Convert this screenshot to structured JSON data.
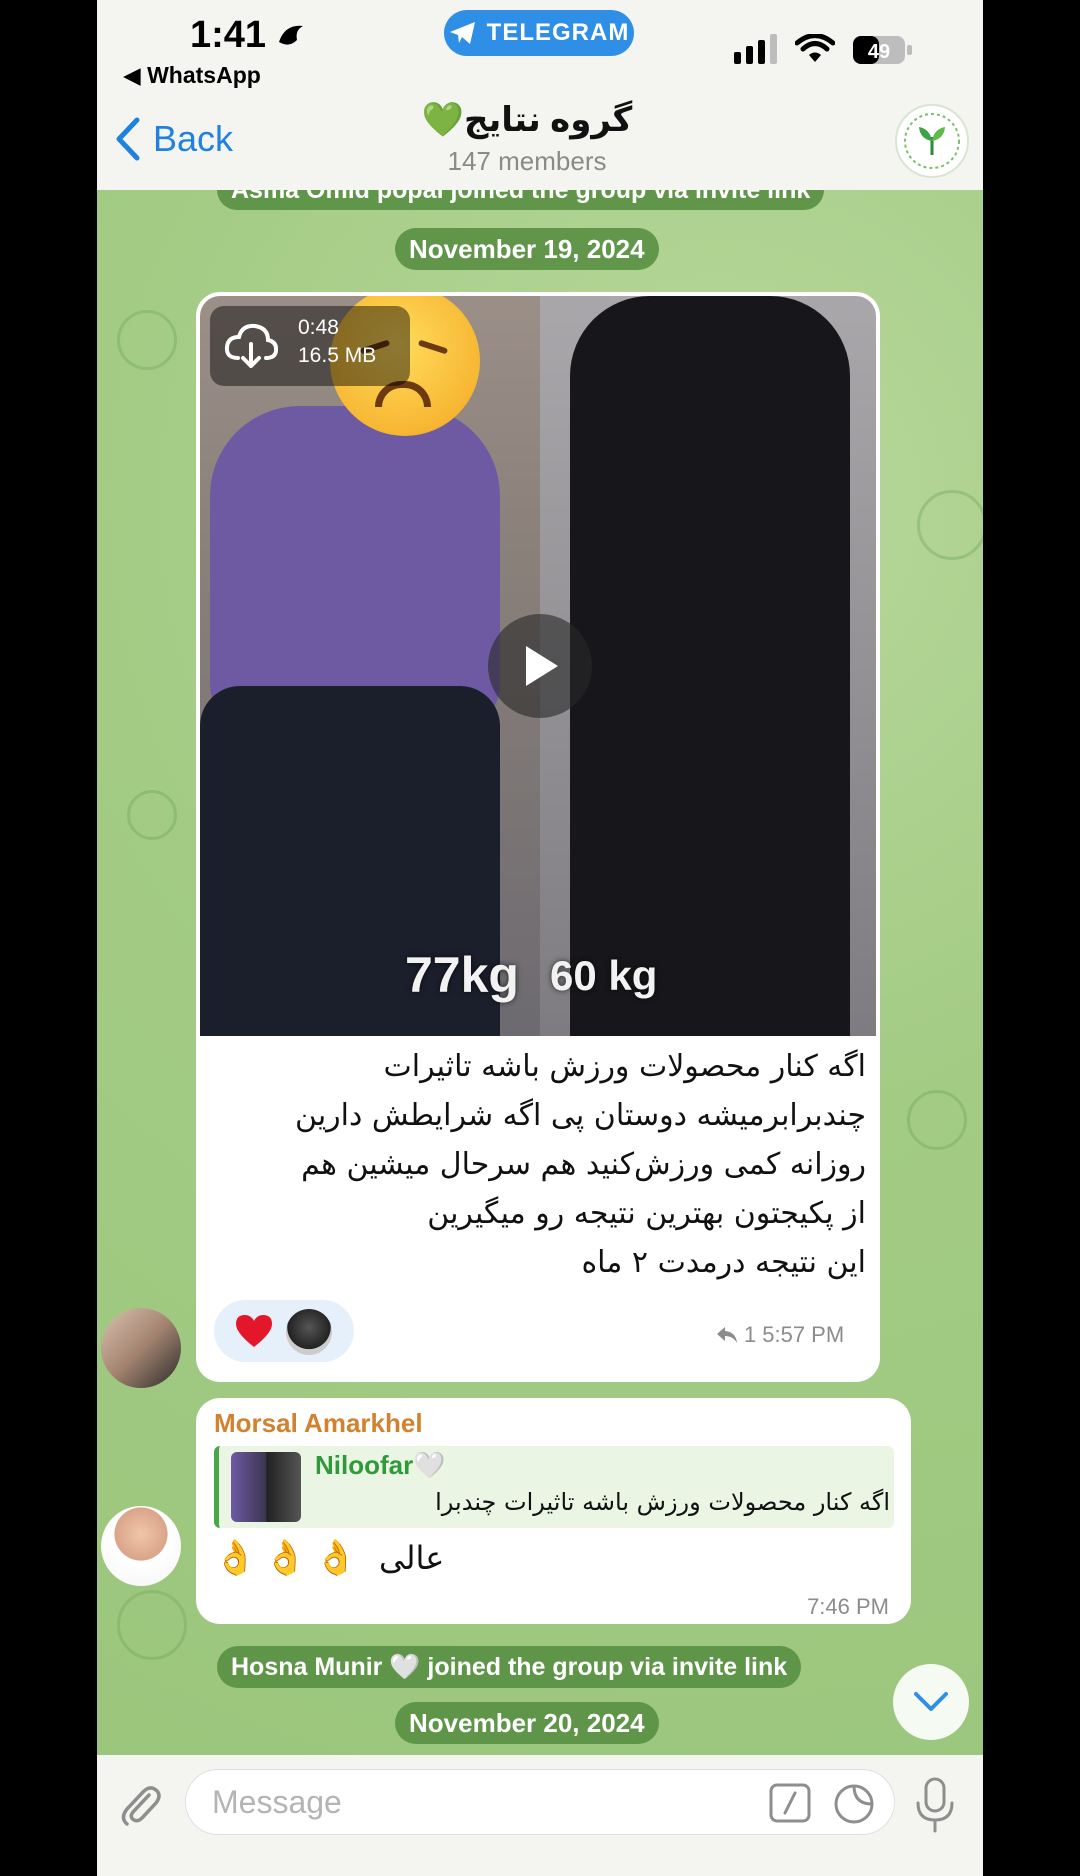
{
  "status_bar": {
    "time": "1:41",
    "back_app": "◀ WhatsApp",
    "telegram_pill": "TELEGRAM",
    "battery": "49"
  },
  "header": {
    "back_label": "Back",
    "title": "گروه نتایج💚",
    "subtitle": "147 members",
    "avatar_icon": "results-leaf-logo"
  },
  "service": {
    "join_top": "Asma Omid popal joined the group via invite link",
    "date1": "November 19, 2024",
    "join_bottom": "Hosna Munir 🤍 joined the group via invite link",
    "date2": "November 20, 2024"
  },
  "message1": {
    "video_duration": "0:48",
    "video_size": "16.5 MB",
    "weight_before": "77kg",
    "weight_after": "60 kg",
    "caption_lines": [
      "اگه کنار محصولات ورزش باشه تاثیرات",
      "چندبرابرمیشه دوستان پی اگه شرایطش دارین",
      "روزانه کمی ورزش‌کنید هم سرحال میشین هم",
      "از پکیجتون بهترین نتیجه رو میگیرین",
      "این نتیجه درمدت ۲ ماه"
    ],
    "reaction_icon": "red-heart",
    "reply_count": "1",
    "time": "5:57 PM"
  },
  "message2": {
    "sender": "Morsal Amarkhel",
    "reply_name": "Niloofar🤍",
    "reply_text": "اگه کنار محصولات ورزش باشه تاثیرات چندبرا",
    "text": "عالی",
    "emoji": "👌",
    "time": "7:46 PM"
  },
  "input": {
    "placeholder": "Message"
  },
  "colors": {
    "accent": "#1f82e0",
    "chat_bg": "#a9cf8c",
    "service_bg": "#548c3e",
    "sender_color": "#d2822f",
    "reply_name_color": "#2f9a3a"
  }
}
